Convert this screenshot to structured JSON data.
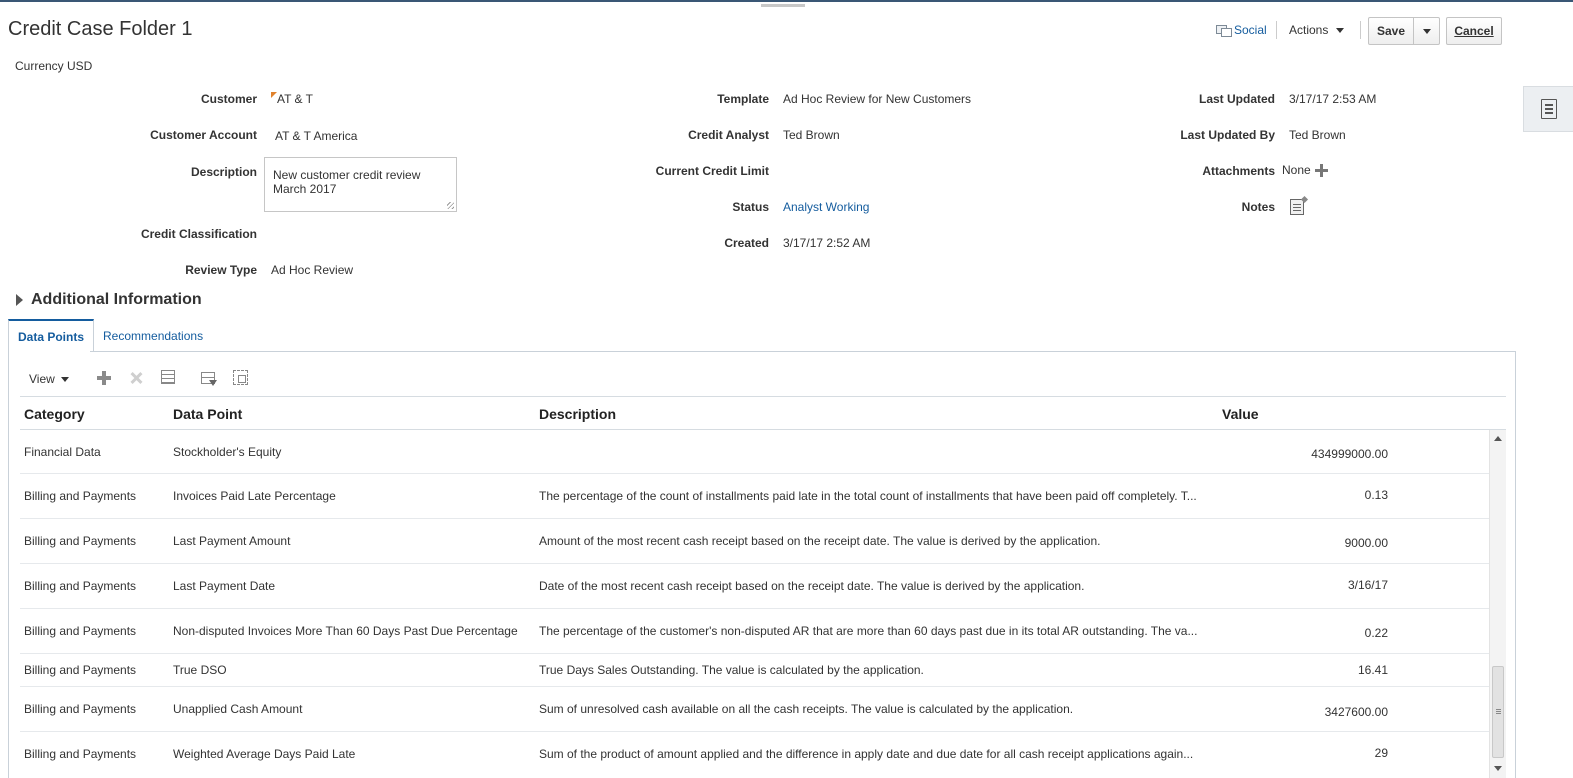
{
  "header": {
    "title": "Credit Case Folder 1",
    "currency": "Currency USD",
    "social": "Social",
    "actions": "Actions",
    "save": "Save",
    "cancel": "Cancel"
  },
  "fields": {
    "customer_label": "Customer",
    "customer_value": "AT & T",
    "customer_account_label": "Customer Account",
    "customer_account_value": "AT & T America",
    "description_label": "Description",
    "description_value": "New customer credit review March 2017",
    "credit_classification_label": "Credit Classification",
    "review_type_label": "Review Type",
    "review_type_value": "Ad Hoc Review",
    "template_label": "Template",
    "template_value": "Ad Hoc Review for New Customers",
    "credit_analyst_label": "Credit Analyst",
    "credit_analyst_value": "Ted Brown",
    "current_credit_limit_label": "Current Credit Limit",
    "status_label": "Status",
    "status_value": "Analyst Working",
    "created_label": "Created",
    "created_value": "3/17/17 2:52 AM",
    "last_updated_label": "Last Updated",
    "last_updated_value": "3/17/17 2:53 AM",
    "last_updated_by_label": "Last Updated By",
    "last_updated_by_value": "Ted Brown",
    "attachments_label": "Attachments",
    "attachments_value": "None",
    "notes_label": "Notes"
  },
  "additional_info": "Additional Information",
  "tabs": [
    {
      "label": "Data Points",
      "active": true
    },
    {
      "label": "Recommendations",
      "active": false
    }
  ],
  "toolbar": {
    "view": "View"
  },
  "table": {
    "columns": [
      "Category",
      "Data Point",
      "Description",
      "Value"
    ],
    "rows": [
      {
        "category": "Financial Data",
        "data_point": "Stockholder's Equity",
        "description": "",
        "value": "434999000.00"
      },
      {
        "category": "Billing and Payments",
        "data_point": "Invoices Paid Late Percentage",
        "description": "The percentage of the count of installments paid late in the total count of installments that have been paid off completely. T...",
        "value": "0.13"
      },
      {
        "category": "Billing and Payments",
        "data_point": "Last Payment Amount",
        "description": "Amount of the most recent cash receipt based on the receipt date. The value is derived by the application.",
        "value": "9000.00"
      },
      {
        "category": "Billing and Payments",
        "data_point": "Last Payment Date",
        "description": "Date of the most recent cash receipt based on the receipt date. The value is derived by the application.",
        "value": "3/16/17"
      },
      {
        "category": "Billing and Payments",
        "data_point": "Non-disputed Invoices More Than 60 Days Past Due Percentage",
        "description": "The percentage of the customer's non-disputed AR that are more than 60 days past due in its total AR outstanding. The va...",
        "value": "0.22"
      },
      {
        "category": "Billing and Payments",
        "data_point": "True DSO",
        "description": "True Days Sales Outstanding. The value is calculated by the application.",
        "value": "16.41"
      },
      {
        "category": "Billing and Payments",
        "data_point": "Unapplied Cash Amount",
        "description": "Sum of unresolved cash available on all the cash receipts. The value is calculated by the application.",
        "value": "3427600.00"
      },
      {
        "category": "Billing and Payments",
        "data_point": "Weighted Average Days Paid Late",
        "description": "Sum of the product of amount applied and the difference in apply date and due date for all cash receipt applications again...",
        "value": "29"
      }
    ]
  },
  "colors": {
    "link": "#145c9e",
    "accent_bar": "#3a5775"
  }
}
